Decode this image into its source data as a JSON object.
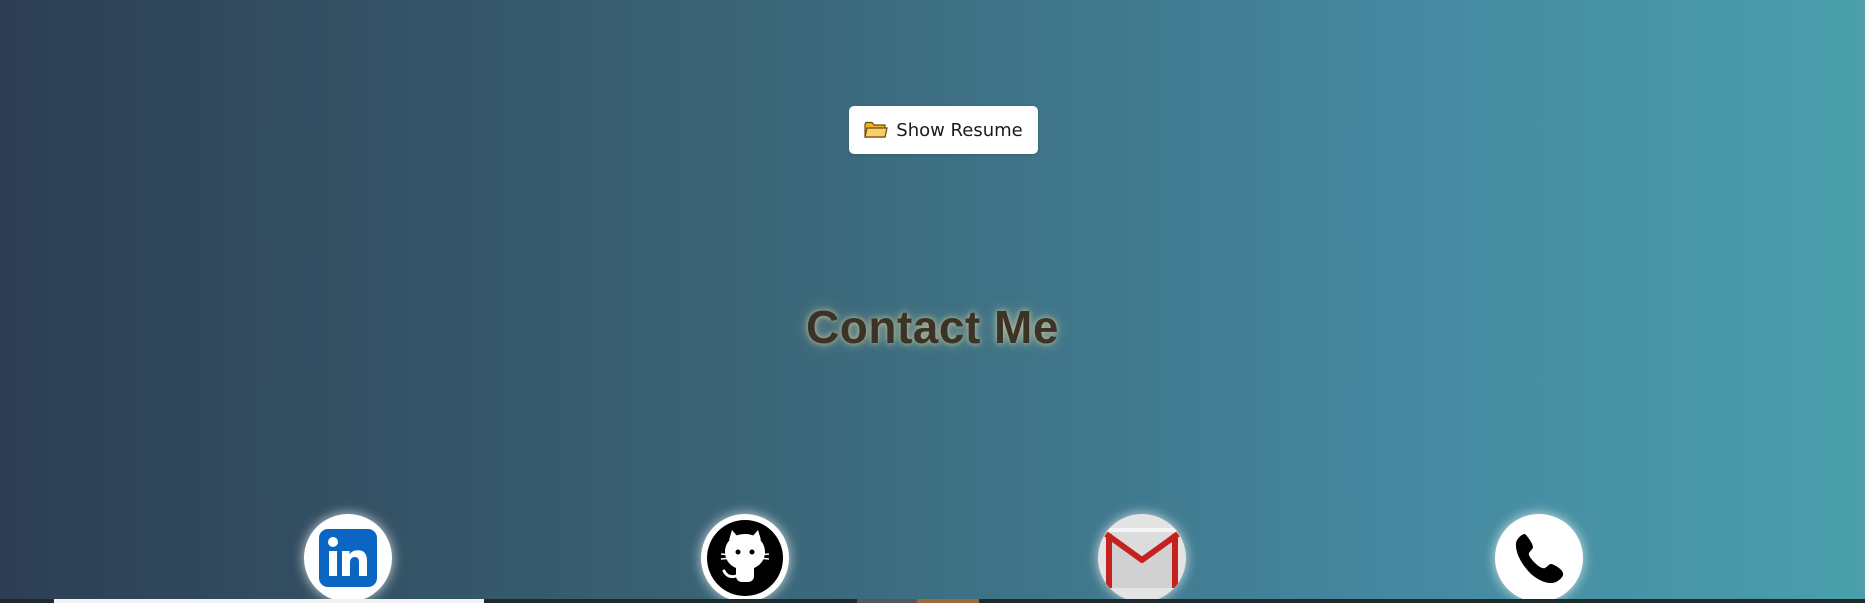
{
  "resume_button": {
    "label": "Show Resume",
    "icon": "folder-icon"
  },
  "contact": {
    "title": "Contact Me"
  },
  "social_links": [
    {
      "name": "linkedin",
      "icon": "linkedin-icon",
      "color": "#0a66c2"
    },
    {
      "name": "github",
      "icon": "github-icon",
      "color": "#000000"
    },
    {
      "name": "gmail",
      "icon": "gmail-icon",
      "color": "#c5221f"
    },
    {
      "name": "phone",
      "icon": "phone-icon",
      "color": "#000000"
    }
  ],
  "colors": {
    "background_start": "#2d3e53",
    "background_end": "#4a9fab",
    "title_text": "#3b3426",
    "title_glow": "#e6d7a0"
  }
}
